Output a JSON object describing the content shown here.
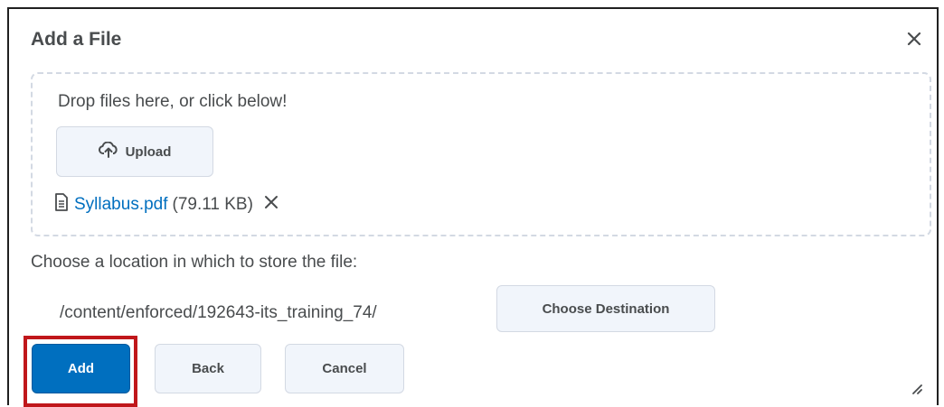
{
  "dialog": {
    "title": "Add a File",
    "close_icon": "close-icon"
  },
  "dropzone": {
    "prompt": "Drop files here, or click below!",
    "upload_label": "Upload",
    "upload_icon": "cloud-upload-icon"
  },
  "file": {
    "icon": "document-icon",
    "name": "Syllabus.pdf",
    "size": "(79.11 KB)",
    "remove_icon": "remove-icon"
  },
  "location": {
    "label": "Choose a location in which to store the file:",
    "path": "/content/enforced/192643-its_training_74/",
    "choose_label": "Choose Destination"
  },
  "actions": {
    "add_label": "Add",
    "back_label": "Back",
    "cancel_label": "Cancel"
  },
  "colors": {
    "primary": "#006fbf",
    "link": "#006fbf",
    "highlight": "#c0171b",
    "secondary_bg": "#f1f5fb"
  }
}
